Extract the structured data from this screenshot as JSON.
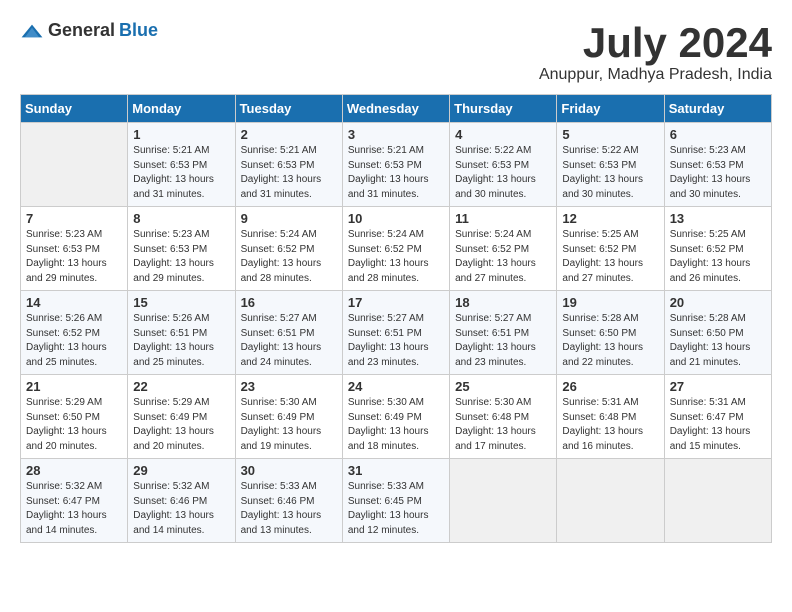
{
  "header": {
    "logo_general": "General",
    "logo_blue": "Blue",
    "month_title": "July 2024",
    "location": "Anuppur, Madhya Pradesh, India"
  },
  "calendar": {
    "headers": [
      "Sunday",
      "Monday",
      "Tuesday",
      "Wednesday",
      "Thursday",
      "Friday",
      "Saturday"
    ],
    "weeks": [
      [
        {
          "day": "",
          "info": ""
        },
        {
          "day": "1",
          "info": "Sunrise: 5:21 AM\nSunset: 6:53 PM\nDaylight: 13 hours\nand 31 minutes."
        },
        {
          "day": "2",
          "info": "Sunrise: 5:21 AM\nSunset: 6:53 PM\nDaylight: 13 hours\nand 31 minutes."
        },
        {
          "day": "3",
          "info": "Sunrise: 5:21 AM\nSunset: 6:53 PM\nDaylight: 13 hours\nand 31 minutes."
        },
        {
          "day": "4",
          "info": "Sunrise: 5:22 AM\nSunset: 6:53 PM\nDaylight: 13 hours\nand 30 minutes."
        },
        {
          "day": "5",
          "info": "Sunrise: 5:22 AM\nSunset: 6:53 PM\nDaylight: 13 hours\nand 30 minutes."
        },
        {
          "day": "6",
          "info": "Sunrise: 5:23 AM\nSunset: 6:53 PM\nDaylight: 13 hours\nand 30 minutes."
        }
      ],
      [
        {
          "day": "7",
          "info": "Sunrise: 5:23 AM\nSunset: 6:53 PM\nDaylight: 13 hours\nand 29 minutes."
        },
        {
          "day": "8",
          "info": "Sunrise: 5:23 AM\nSunset: 6:53 PM\nDaylight: 13 hours\nand 29 minutes."
        },
        {
          "day": "9",
          "info": "Sunrise: 5:24 AM\nSunset: 6:52 PM\nDaylight: 13 hours\nand 28 minutes."
        },
        {
          "day": "10",
          "info": "Sunrise: 5:24 AM\nSunset: 6:52 PM\nDaylight: 13 hours\nand 28 minutes."
        },
        {
          "day": "11",
          "info": "Sunrise: 5:24 AM\nSunset: 6:52 PM\nDaylight: 13 hours\nand 27 minutes."
        },
        {
          "day": "12",
          "info": "Sunrise: 5:25 AM\nSunset: 6:52 PM\nDaylight: 13 hours\nand 27 minutes."
        },
        {
          "day": "13",
          "info": "Sunrise: 5:25 AM\nSunset: 6:52 PM\nDaylight: 13 hours\nand 26 minutes."
        }
      ],
      [
        {
          "day": "14",
          "info": "Sunrise: 5:26 AM\nSunset: 6:52 PM\nDaylight: 13 hours\nand 25 minutes."
        },
        {
          "day": "15",
          "info": "Sunrise: 5:26 AM\nSunset: 6:51 PM\nDaylight: 13 hours\nand 25 minutes."
        },
        {
          "day": "16",
          "info": "Sunrise: 5:27 AM\nSunset: 6:51 PM\nDaylight: 13 hours\nand 24 minutes."
        },
        {
          "day": "17",
          "info": "Sunrise: 5:27 AM\nSunset: 6:51 PM\nDaylight: 13 hours\nand 23 minutes."
        },
        {
          "day": "18",
          "info": "Sunrise: 5:27 AM\nSunset: 6:51 PM\nDaylight: 13 hours\nand 23 minutes."
        },
        {
          "day": "19",
          "info": "Sunrise: 5:28 AM\nSunset: 6:50 PM\nDaylight: 13 hours\nand 22 minutes."
        },
        {
          "day": "20",
          "info": "Sunrise: 5:28 AM\nSunset: 6:50 PM\nDaylight: 13 hours\nand 21 minutes."
        }
      ],
      [
        {
          "day": "21",
          "info": "Sunrise: 5:29 AM\nSunset: 6:50 PM\nDaylight: 13 hours\nand 20 minutes."
        },
        {
          "day": "22",
          "info": "Sunrise: 5:29 AM\nSunset: 6:49 PM\nDaylight: 13 hours\nand 20 minutes."
        },
        {
          "day": "23",
          "info": "Sunrise: 5:30 AM\nSunset: 6:49 PM\nDaylight: 13 hours\nand 19 minutes."
        },
        {
          "day": "24",
          "info": "Sunrise: 5:30 AM\nSunset: 6:49 PM\nDaylight: 13 hours\nand 18 minutes."
        },
        {
          "day": "25",
          "info": "Sunrise: 5:30 AM\nSunset: 6:48 PM\nDaylight: 13 hours\nand 17 minutes."
        },
        {
          "day": "26",
          "info": "Sunrise: 5:31 AM\nSunset: 6:48 PM\nDaylight: 13 hours\nand 16 minutes."
        },
        {
          "day": "27",
          "info": "Sunrise: 5:31 AM\nSunset: 6:47 PM\nDaylight: 13 hours\nand 15 minutes."
        }
      ],
      [
        {
          "day": "28",
          "info": "Sunrise: 5:32 AM\nSunset: 6:47 PM\nDaylight: 13 hours\nand 14 minutes."
        },
        {
          "day": "29",
          "info": "Sunrise: 5:32 AM\nSunset: 6:46 PM\nDaylight: 13 hours\nand 14 minutes."
        },
        {
          "day": "30",
          "info": "Sunrise: 5:33 AM\nSunset: 6:46 PM\nDaylight: 13 hours\nand 13 minutes."
        },
        {
          "day": "31",
          "info": "Sunrise: 5:33 AM\nSunset: 6:45 PM\nDaylight: 13 hours\nand 12 minutes."
        },
        {
          "day": "",
          "info": ""
        },
        {
          "day": "",
          "info": ""
        },
        {
          "day": "",
          "info": ""
        }
      ]
    ]
  }
}
